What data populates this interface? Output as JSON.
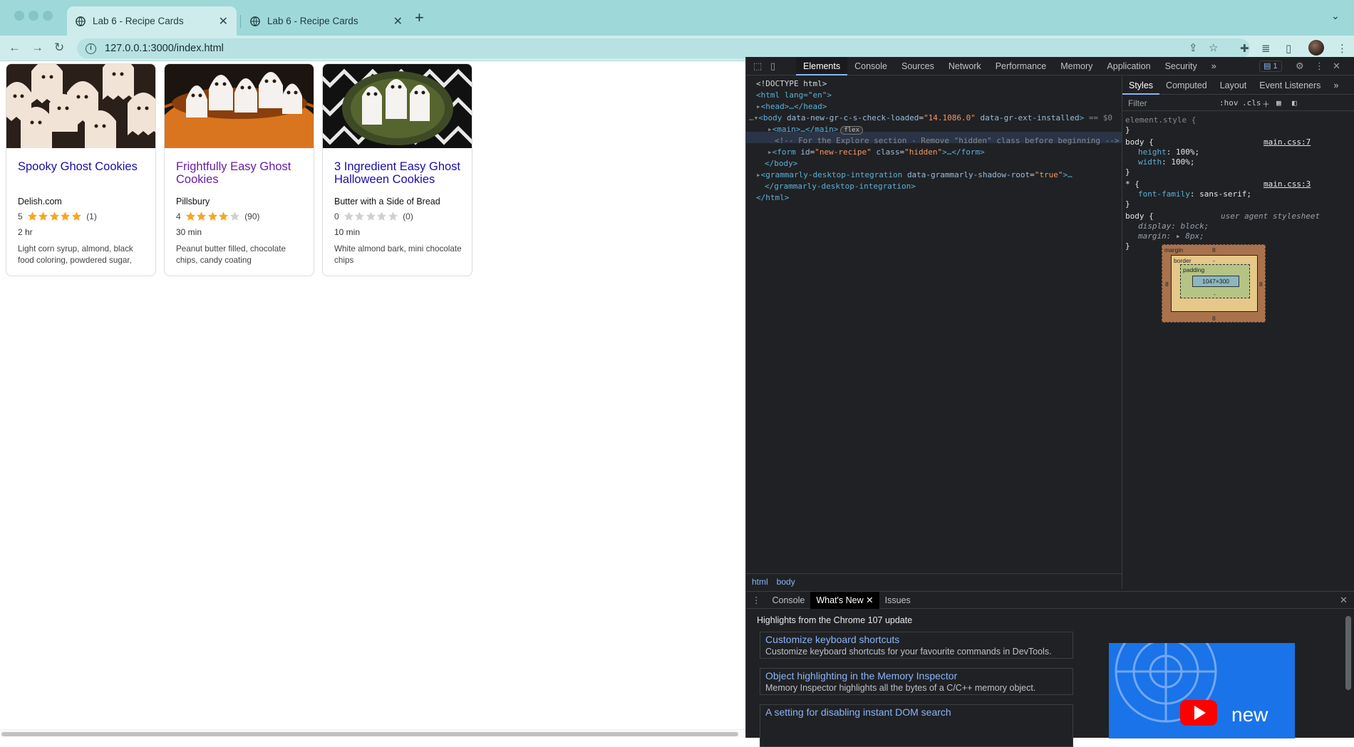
{
  "browser": {
    "tabs": [
      {
        "label": "Lab 6 - Recipe Cards",
        "active": true
      },
      {
        "label": "Lab 6 - Recipe Cards",
        "active": false
      }
    ],
    "url": "127.0.0.1:3000/index.html"
  },
  "recipes": [
    {
      "title": "Spooky Ghost Cookies",
      "org": "Delish.com",
      "rating": "5",
      "reviews": "(1)",
      "stars": 5,
      "time": "2 hr",
      "ingredients": "Light corn syrup, almond, black food coloring, powdered sugar,",
      "visited": false
    },
    {
      "title": "Frightfully Easy Ghost Cookies",
      "org": "Pillsbury",
      "rating": "4",
      "reviews": "(90)",
      "stars": 4,
      "time": "30 min",
      "ingredients": "Peanut butter filled, chocolate chips, candy coating",
      "visited": true
    },
    {
      "title": "3 Ingredient Easy Ghost Halloween Cookies",
      "org": "Butter with a Side of Bread",
      "rating": "0",
      "reviews": "(0)",
      "stars": 0,
      "time": "10 min",
      "ingredients": "White almond bark, mini chocolate chips",
      "visited": false
    }
  ],
  "devtools": {
    "tabs": [
      "Elements",
      "Console",
      "Sources",
      "Network",
      "Performance",
      "Memory",
      "Application",
      "Security"
    ],
    "more": "»",
    "issues_count": "1",
    "dom": {
      "doctype": "<!DOCTYPE html>",
      "html_open": "<html lang=\"en\">",
      "head": "<head>…</head>",
      "body_open_tag": "<body",
      "body_attr1": "data-new-gr-c-s-check-loaded",
      "body_val1": "\"14.1086.0\"",
      "body_attr2": "data-gr-ext-installed",
      "body_close_bracket": ">",
      "selected_marker": "== $0",
      "main": "<main>…</main>",
      "flex_badge": "flex",
      "comment": "<!-- For the Explore section - Remove \"hidden\" class before beginning -->",
      "form_tag": "<form",
      "form_attr_id": "id",
      "form_val_id": "\"new-recipe\"",
      "form_attr_class": "class",
      "form_val_class": "\"hidden\"",
      "form_end": ">…</form>",
      "body_close": "</body>",
      "gram_open": "<grammarly-desktop-integration",
      "gram_attr": "data-grammarly-shadow-root",
      "gram_val": "\"true\"",
      "gram_end": ">…",
      "gram_close": "</grammarly-desktop-integration>",
      "html_close": "</html>"
    },
    "breadcrumb": [
      "html",
      "body"
    ],
    "styles_tabs": [
      "Styles",
      "Computed",
      "Layout",
      "Event Listeners"
    ],
    "filter_placeholder": "Filter",
    "hov": ":hov",
    "cls": ".cls",
    "rules": {
      "element_style": "element.style {",
      "close": "}",
      "body1_selector": "body {",
      "body1_source": "main.css:7",
      "height_prop": "height",
      "height_val": "100%;",
      "width_prop": "width",
      "width_val": "100%;",
      "star_selector": "* {",
      "star_source": "main.css:3",
      "font_prop": "font-family",
      "font_val": "sans-serif;",
      "body2_selector": "body {",
      "body2_source": "user agent stylesheet",
      "display_prop": "display",
      "display_val": "block;",
      "margin_prop": "margin",
      "margin_val": "8px;"
    },
    "box_model": {
      "margin_label": "margin",
      "margin_top": "8",
      "margin_bottom": "8",
      "margin_left": "8",
      "margin_right": "8",
      "border_label": "border",
      "border_val": "-",
      "padding_label": "padding",
      "padding_val": "-",
      "content": "1047×300"
    },
    "drawer": {
      "tabs": [
        "Console",
        "What's New",
        "Issues"
      ],
      "headline": "Highlights from the Chrome 107 update",
      "items": [
        {
          "title": "Customize keyboard shortcuts",
          "desc": "Customize keyboard shortcuts for your favourite commands in DevTools."
        },
        {
          "title": "Object highlighting in the Memory Inspector",
          "desc": "Memory Inspector highlights all the bytes of a C/C++ memory object."
        },
        {
          "title": "A setting for disabling instant DOM search",
          "desc": ""
        }
      ],
      "promo_text": "new"
    }
  },
  "colors": {
    "link": "#1a0dab",
    "visited": "#681da8",
    "star": "#f5a623",
    "star_empty": "#d0d0d0"
  }
}
